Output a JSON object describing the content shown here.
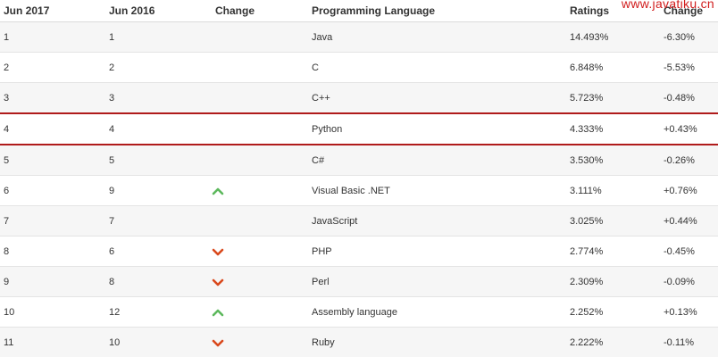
{
  "watermark": "www.javatiku.cn",
  "headers": {
    "current": "Jun 2017",
    "previous": "Jun 2016",
    "change": "Change",
    "language": "Programming Language",
    "ratings": "Ratings",
    "rating_change": "Change"
  },
  "colors": {
    "up": "#5cb85c",
    "down": "#d9481c",
    "highlight_border": "#b01b1b"
  },
  "rows": [
    {
      "current": "1",
      "previous": "1",
      "trend": "none",
      "language": "Java",
      "rating": "14.493%",
      "change": "-6.30%"
    },
    {
      "current": "2",
      "previous": "2",
      "trend": "none",
      "language": "C",
      "rating": "6.848%",
      "change": "-5.53%"
    },
    {
      "current": "3",
      "previous": "3",
      "trend": "none",
      "language": "C++",
      "rating": "5.723%",
      "change": "-0.48%"
    },
    {
      "current": "4",
      "previous": "4",
      "trend": "none",
      "language": "Python",
      "rating": "4.333%",
      "change": "+0.43%"
    },
    {
      "current": "5",
      "previous": "5",
      "trend": "none",
      "language": "C#",
      "rating": "3.530%",
      "change": "-0.26%"
    },
    {
      "current": "6",
      "previous": "9",
      "trend": "up",
      "language": "Visual Basic .NET",
      "rating": "3.111%",
      "change": "+0.76%"
    },
    {
      "current": "7",
      "previous": "7",
      "trend": "none",
      "language": "JavaScript",
      "rating": "3.025%",
      "change": "+0.44%"
    },
    {
      "current": "8",
      "previous": "6",
      "trend": "down",
      "language": "PHP",
      "rating": "2.774%",
      "change": "-0.45%"
    },
    {
      "current": "9",
      "previous": "8",
      "trend": "down",
      "language": "Perl",
      "rating": "2.309%",
      "change": "-0.09%"
    },
    {
      "current": "10",
      "previous": "12",
      "trend": "up",
      "language": "Assembly language",
      "rating": "2.252%",
      "change": "+0.13%"
    },
    {
      "current": "11",
      "previous": "10",
      "trend": "down",
      "language": "Ruby",
      "rating": "2.222%",
      "change": "-0.11%"
    }
  ]
}
